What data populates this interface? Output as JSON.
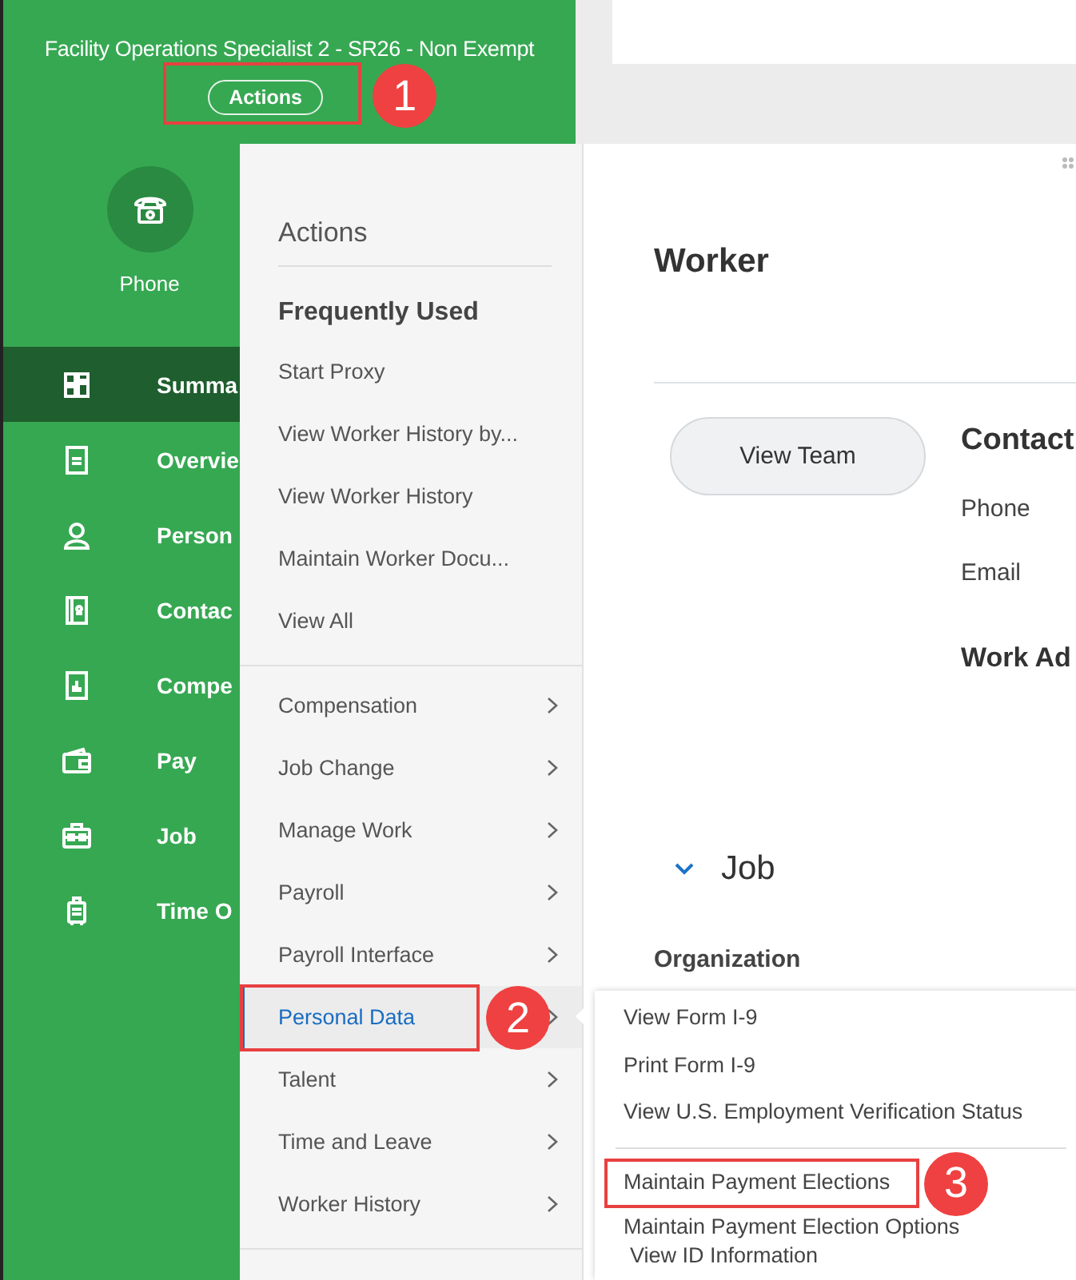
{
  "header": {
    "title": "Facility Operations Specialist 2 - SR26 - Non Exempt",
    "actions_button": {
      "label": "Actions",
      "highlighted": true,
      "callout": "1"
    }
  },
  "phone_action": {
    "label": "Phone"
  },
  "sidebar": {
    "items": [
      {
        "label": "Summa",
        "selected": true
      },
      {
        "label": "Overvie",
        "selected": false
      },
      {
        "label": "Person",
        "selected": false
      },
      {
        "label": "Contac",
        "selected": false
      },
      {
        "label": "Compe",
        "selected": false
      },
      {
        "label": "Pay",
        "selected": false
      },
      {
        "label": "Job",
        "selected": false
      },
      {
        "label": "Time O",
        "selected": false
      }
    ]
  },
  "actions_menu": {
    "title": "Actions",
    "frequent": {
      "heading": "Frequently Used",
      "items": [
        "Start Proxy",
        "View Worker History by...",
        "View Worker History",
        "Maintain Worker Docu...",
        "View All"
      ]
    },
    "categories": [
      {
        "label": "Compensation",
        "selected": false,
        "highlighted": false
      },
      {
        "label": "Job Change",
        "selected": false,
        "highlighted": false
      },
      {
        "label": "Manage Work",
        "selected": false,
        "highlighted": false
      },
      {
        "label": "Payroll",
        "selected": false,
        "highlighted": false
      },
      {
        "label": "Payroll Interface",
        "selected": false,
        "highlighted": false
      },
      {
        "label": "Personal Data",
        "selected": true,
        "highlighted": true,
        "callout": "2"
      },
      {
        "label": "Talent",
        "selected": false,
        "highlighted": false
      },
      {
        "label": "Time and Leave",
        "selected": false,
        "highlighted": false
      },
      {
        "label": "Worker History",
        "selected": false,
        "highlighted": false
      }
    ]
  },
  "submenu": {
    "groups": [
      [
        {
          "label": "View Form I-9",
          "highlighted": false
        },
        {
          "label": "Print Form I-9",
          "highlighted": false
        },
        {
          "label": "View U.S. Employment Verification Status",
          "highlighted": false
        }
      ],
      [
        {
          "label": "Maintain Payment Elections",
          "highlighted": true,
          "callout": "3"
        },
        {
          "label": "Maintain Payment Election Options",
          "highlighted": false
        },
        {
          "label": "View ID Information",
          "highlighted": false
        }
      ]
    ]
  },
  "worker": {
    "title": "Worker",
    "view_team_button": "View Team",
    "contact": {
      "title": "Contact",
      "fields": [
        "Phone",
        "Email"
      ],
      "work_address_title": "Work Ad"
    }
  },
  "job": {
    "title": "Job",
    "expanded": true,
    "organization_label": "Organization"
  }
}
